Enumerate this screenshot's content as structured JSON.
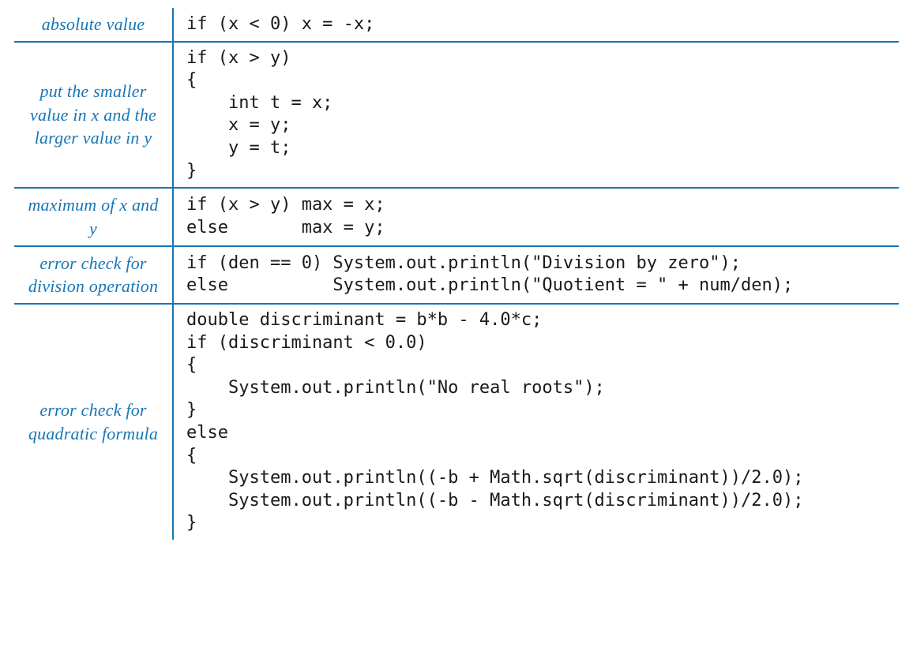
{
  "rows": [
    {
      "label": "absolute value",
      "code": "if (x < 0) x = -x;"
    },
    {
      "label": "put the smaller\nvalue in x\nand the larger\nvalue in y",
      "code": "if (x > y)\n{\n    int t = x;\n    x = y;\n    y = t;\n}"
    },
    {
      "label": "maximum of\nx and y",
      "code": "if (x > y) max = x;\nelse       max = y;"
    },
    {
      "label": "error check\nfor division\noperation",
      "code": "if (den == 0) System.out.println(\"Division by zero\");\nelse          System.out.println(\"Quotient = \" + num/den);"
    },
    {
      "label": "error check\nfor quadratic\nformula",
      "code": "double discriminant = b*b - 4.0*c;\nif (discriminant < 0.0)\n{\n    System.out.println(\"No real roots\");\n}\nelse\n{\n    System.out.println((-b + Math.sqrt(discriminant))/2.0);\n    System.out.println((-b - Math.sqrt(discriminant))/2.0);\n}"
    }
  ]
}
